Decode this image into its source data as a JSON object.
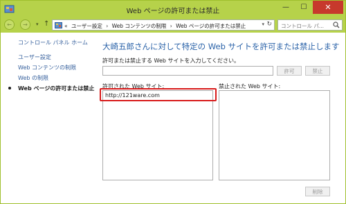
{
  "window": {
    "title": "Web ページの許可または禁止",
    "minimize": "—",
    "maximize": "☐",
    "close": "✕"
  },
  "nav": {
    "back": "←",
    "forward": "→",
    "dropdown": "▾",
    "up": "↑",
    "breadcrumb": [
      "«",
      "ユーザー設定",
      "›",
      "Web コンテンツの制限",
      "›",
      "Web ページの許可または禁止"
    ],
    "address_dropdown": "▾",
    "refresh": "↻",
    "search_placeholder": "コントロール パ..."
  },
  "left_nav": {
    "home": "コントロール パネル ホーム",
    "items": [
      {
        "label": "ユーザー設定",
        "active": false
      },
      {
        "label": "Web コンテンツの制限",
        "active": false
      },
      {
        "label": "Web の制限",
        "active": false
      },
      {
        "label": "Web ページの許可または禁止",
        "active": true
      }
    ]
  },
  "main": {
    "heading": "大崎五郎さんに対して特定の Web サイトを許可または禁止します",
    "instruction": "許可または禁止する Web サイトを入力してください。",
    "site_input_value": "",
    "allow_button": "許可",
    "block_button": "禁止",
    "allowed_label": "許可された Web サイト:",
    "blocked_label": "禁止された Web サイト:",
    "allowed_sites": [
      "http://121ware.com"
    ],
    "blocked_sites": [],
    "delete_button": "削除"
  },
  "colors": {
    "chrome": "#b6d24a",
    "heading": "#2a62a8",
    "link": "#335e9b",
    "highlight": "#d81a1a",
    "close": "#c7392c"
  }
}
